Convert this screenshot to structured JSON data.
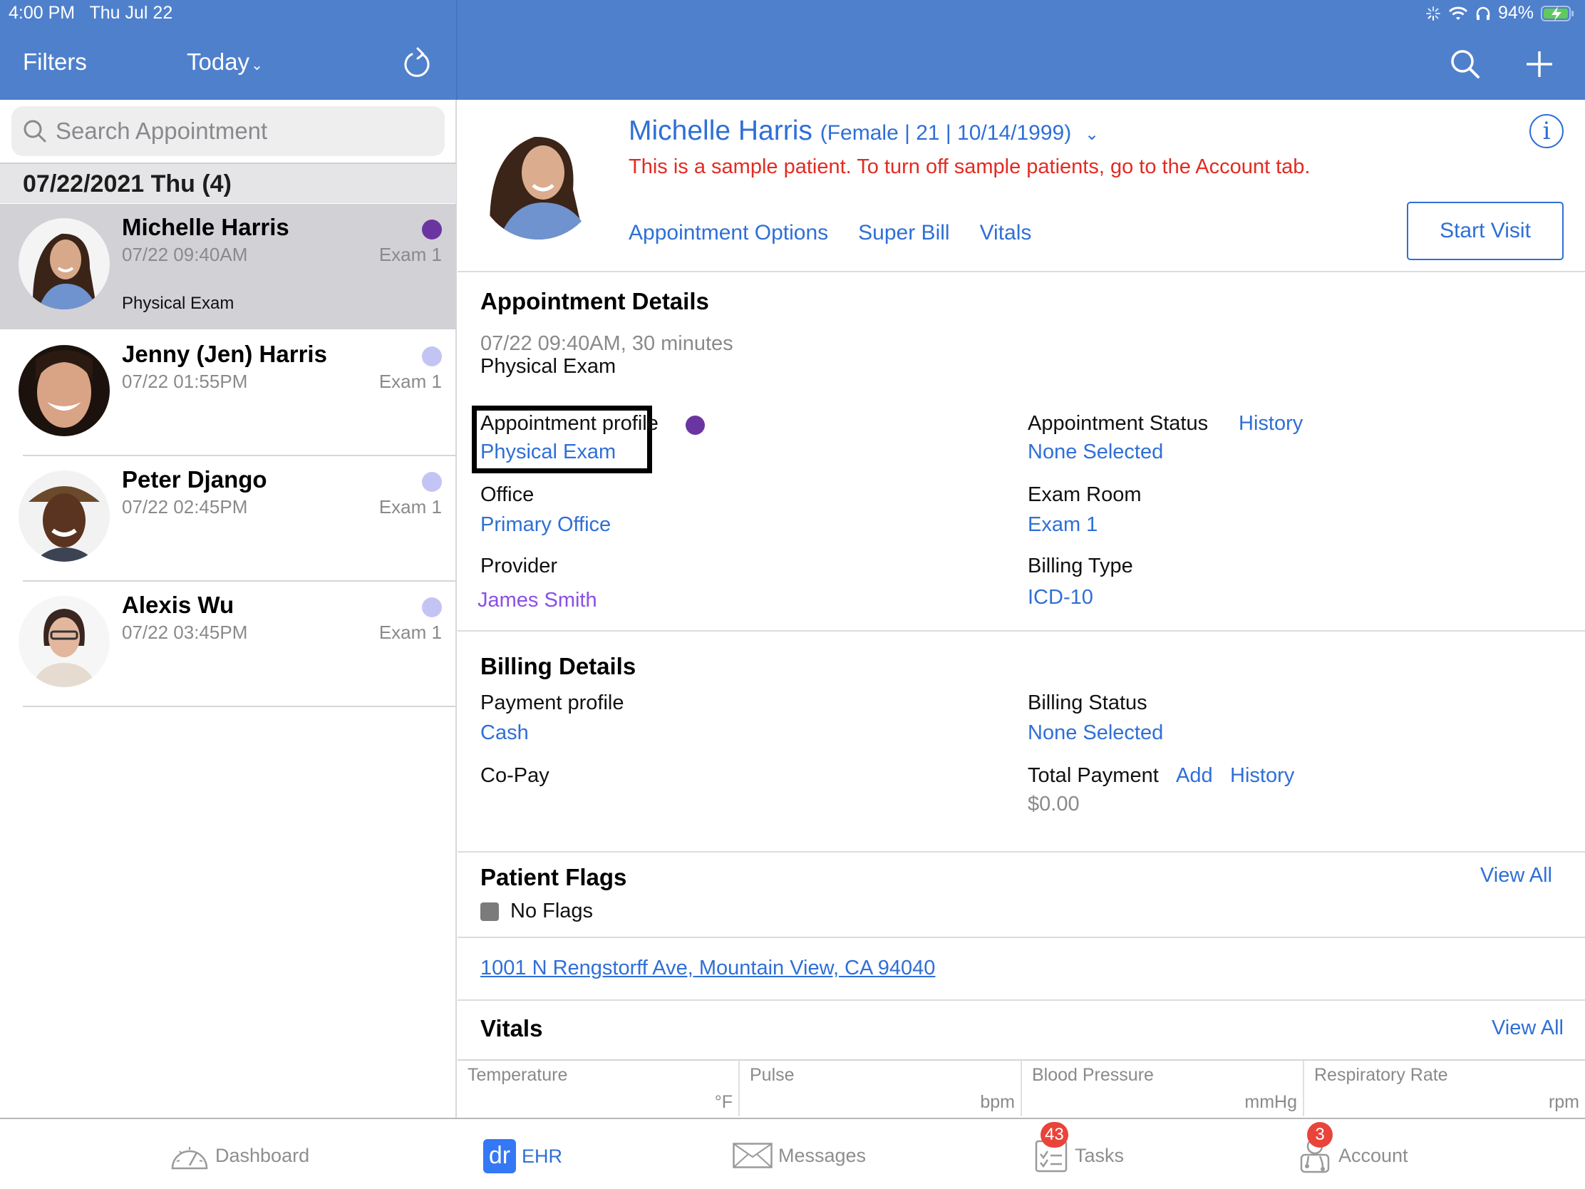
{
  "status_bar": {
    "time": "4:00 PM",
    "date": "Thu Jul 22",
    "battery": "94%"
  },
  "nav": {
    "filters_label": "Filters",
    "date_filter_label": "Today",
    "refresh_icon": "refresh-icon",
    "search_icon": "search-icon",
    "add_icon": "plus-icon"
  },
  "sidebar": {
    "search_placeholder": "Search Appointment",
    "date_header": "07/22/2021 Thu (4)",
    "appointments": [
      {
        "name": "Michelle Harris",
        "time": "07/22 09:40AM",
        "room": "Exam 1",
        "type": "Physical Exam",
        "status_color": "#6a35a0",
        "selected": true
      },
      {
        "name": "Jenny (Jen) Harris",
        "time": "07/22 01:55PM",
        "room": "Exam 1",
        "type": "",
        "status_color": "#c4c4f4",
        "selected": false
      },
      {
        "name": "Peter Django",
        "time": "07/22 02:45PM",
        "room": "Exam 1",
        "type": "",
        "status_color": "#c4c4f4",
        "selected": false
      },
      {
        "name": "Alexis Wu",
        "time": "07/22 03:45PM",
        "room": "Exam 1",
        "type": "",
        "status_color": "#c4c4f4",
        "selected": false
      }
    ]
  },
  "patient": {
    "name": "Michelle Harris",
    "meta": "(Female | 21 | 10/14/1999)",
    "sample_notice": "This is a sample patient. To turn off sample patients, go to the Account tab.",
    "links": [
      "Appointment Options",
      "Super Bill",
      "Vitals"
    ],
    "start_visit_label": "Start Visit",
    "info_icon": "info-icon"
  },
  "appointment_details": {
    "title": "Appointment Details",
    "datetime": "07/22 09:40AM, 30 minutes",
    "type": "Physical Exam",
    "profile_label": "Appointment profile",
    "profile_value": "Physical Exam",
    "profile_color": "#6a35a0",
    "status_label": "Appointment Status",
    "status_history": "History",
    "status_value": "None Selected",
    "office_label": "Office",
    "office_value": "Primary Office",
    "exam_room_label": "Exam Room",
    "exam_room_value": "Exam 1",
    "provider_label": "Provider",
    "provider_value": "James Smith",
    "billing_type_label": "Billing Type",
    "billing_type_value": "ICD-10"
  },
  "billing_details": {
    "title": "Billing Details",
    "payment_profile_label": "Payment profile",
    "payment_profile_value": "Cash",
    "billing_status_label": "Billing Status",
    "billing_status_value": "None Selected",
    "copay_label": "Co-Pay",
    "total_payment_label": "Total Payment",
    "add_label": "Add",
    "history_label": "History",
    "total_payment_value": "$0.00"
  },
  "patient_flags": {
    "title": "Patient Flags",
    "view_all": "View All",
    "no_flags": "No Flags"
  },
  "address": "1001 N Rengstorff Ave, Mountain View, CA 94040",
  "vitals": {
    "title": "Vitals",
    "view_all": "View All",
    "fields": [
      {
        "label": "Temperature",
        "unit": "°F"
      },
      {
        "label": "Pulse",
        "unit": "bpm"
      },
      {
        "label": "Blood Pressure",
        "unit": "mmHg"
      },
      {
        "label": "Respiratory Rate",
        "unit": "rpm"
      }
    ]
  },
  "tabbar": {
    "tabs": [
      {
        "label": "Dashboard",
        "icon": "dashboard-gauge-icon",
        "active": false
      },
      {
        "label": "EHR",
        "icon": "dr-logo-icon",
        "icon_text": "dr",
        "active": true
      },
      {
        "label": "Messages",
        "icon": "envelope-icon",
        "active": false
      },
      {
        "label": "Tasks",
        "icon": "checklist-icon",
        "badge": "43",
        "active": false
      },
      {
        "label": "Account",
        "icon": "doctor-icon",
        "badge": "3",
        "active": false
      }
    ]
  }
}
